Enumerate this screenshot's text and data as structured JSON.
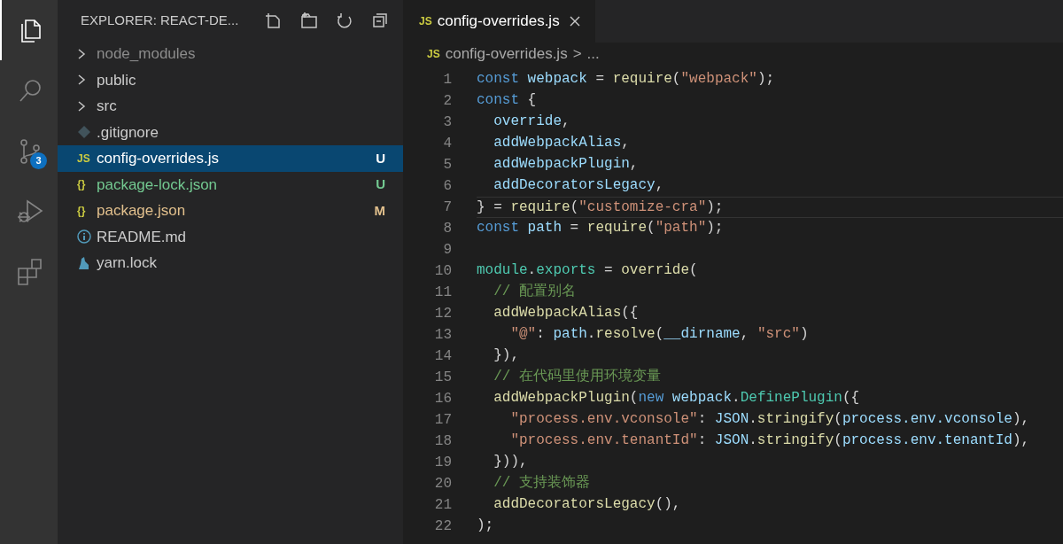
{
  "activity_bar": {
    "items": [
      {
        "kind": "files",
        "selected": true
      },
      {
        "kind": "search",
        "selected": false
      },
      {
        "kind": "source-control",
        "selected": false,
        "badge": "3"
      },
      {
        "kind": "debug",
        "selected": false
      },
      {
        "kind": "extensions",
        "selected": false
      }
    ]
  },
  "sidebar": {
    "title": "EXPLORER: REACT-DE...",
    "tree": [
      {
        "label": "node_modules",
        "kind": "folder",
        "expanded": false,
        "ignored": true
      },
      {
        "label": "public",
        "kind": "folder",
        "expanded": false,
        "ignored": false
      },
      {
        "label": "src",
        "kind": "folder",
        "expanded": false,
        "ignored": false
      },
      {
        "label": ".gitignore",
        "kind": "git-file",
        "selected": false
      },
      {
        "label": "config-overrides.js",
        "kind": "typed-file",
        "icon_text": "JS",
        "status": "U",
        "selected": true
      },
      {
        "label": "package-lock.json",
        "kind": "typed-file",
        "icon_text": "{}",
        "status": "U",
        "selected": false
      },
      {
        "label": "package.json",
        "kind": "typed-file",
        "icon_text": "{}",
        "status": "M",
        "selected": false
      },
      {
        "label": "README.md",
        "kind": "info-file",
        "selected": false
      },
      {
        "label": "yarn.lock",
        "kind": "yarn-file",
        "selected": false
      }
    ]
  },
  "tabs": [
    {
      "label": "config-overrides.js",
      "icon_text": "JS",
      "selected": true
    }
  ],
  "breadcrumb": {
    "icon_text": "JS",
    "file": "config-overrides.js",
    "separator": ">",
    "rest": "..."
  },
  "editor": {
    "lines": [
      {
        "number": "1",
        "current": false,
        "tokens": [
          {
            "text": "const ",
            "kind": "keyword"
          },
          {
            "text": "webpack",
            "kind": "variable"
          },
          {
            "text": " = ",
            "kind": "punct"
          },
          {
            "text": "require",
            "kind": "function"
          },
          {
            "text": "(",
            "kind": "punct"
          },
          {
            "text": "\"webpack\"",
            "kind": "string"
          },
          {
            "text": ");",
            "kind": "punct"
          }
        ]
      },
      {
        "number": "2",
        "current": false,
        "tokens": [
          {
            "text": "const ",
            "kind": "keyword"
          },
          {
            "text": "{",
            "kind": "punct"
          }
        ]
      },
      {
        "number": "3",
        "current": false,
        "tokens": [
          {
            "text": "  override",
            "kind": "variable"
          },
          {
            "text": ",",
            "kind": "punct"
          }
        ]
      },
      {
        "number": "4",
        "current": false,
        "tokens": [
          {
            "text": "  addWebpackAlias",
            "kind": "variable"
          },
          {
            "text": ",",
            "kind": "punct"
          }
        ]
      },
      {
        "number": "5",
        "current": false,
        "tokens": [
          {
            "text": "  addWebpackPlugin",
            "kind": "variable"
          },
          {
            "text": ",",
            "kind": "punct"
          }
        ]
      },
      {
        "number": "6",
        "current": false,
        "tokens": [
          {
            "text": "  addDecoratorsLegacy",
            "kind": "variable"
          },
          {
            "text": ",",
            "kind": "punct"
          }
        ]
      },
      {
        "number": "7",
        "current": true,
        "tokens": [
          {
            "text": "} = ",
            "kind": "punct"
          },
          {
            "text": "require",
            "kind": "function"
          },
          {
            "text": "(",
            "kind": "punct"
          },
          {
            "text": "\"customize-cra\"",
            "kind": "string"
          },
          {
            "text": ");",
            "kind": "punct"
          }
        ]
      },
      {
        "number": "8",
        "current": false,
        "tokens": [
          {
            "text": "const ",
            "kind": "keyword"
          },
          {
            "text": "path",
            "kind": "variable"
          },
          {
            "text": " = ",
            "kind": "punct"
          },
          {
            "text": "require",
            "kind": "function"
          },
          {
            "text": "(",
            "kind": "punct"
          },
          {
            "text": "\"path\"",
            "kind": "string"
          },
          {
            "text": ");",
            "kind": "punct"
          }
        ]
      },
      {
        "number": "9",
        "current": false
      },
      {
        "number": "10",
        "current": false,
        "tokens": [
          {
            "text": "module",
            "kind": "type"
          },
          {
            "text": ".",
            "kind": "punct"
          },
          {
            "text": "exports",
            "kind": "type"
          },
          {
            "text": " = ",
            "kind": "punct"
          },
          {
            "text": "override",
            "kind": "function"
          },
          {
            "text": "(",
            "kind": "punct"
          }
        ]
      },
      {
        "number": "11",
        "current": false,
        "tokens": [
          {
            "text": "  // 配置别名",
            "kind": "comment"
          }
        ]
      },
      {
        "number": "12",
        "current": false,
        "tokens": [
          {
            "text": "  addWebpackAlias",
            "kind": "function"
          },
          {
            "text": "({",
            "kind": "punct"
          }
        ]
      },
      {
        "number": "13",
        "current": false,
        "tokens": [
          {
            "text": "    \"@\"",
            "kind": "string"
          },
          {
            "text": ": ",
            "kind": "punct"
          },
          {
            "text": "path",
            "kind": "variable"
          },
          {
            "text": ".",
            "kind": "punct"
          },
          {
            "text": "resolve",
            "kind": "function"
          },
          {
            "text": "(",
            "kind": "punct"
          },
          {
            "text": "__dirname",
            "kind": "variable"
          },
          {
            "text": ", ",
            "kind": "punct"
          },
          {
            "text": "\"src\"",
            "kind": "string"
          },
          {
            "text": ")",
            "kind": "punct"
          }
        ]
      },
      {
        "number": "14",
        "current": false,
        "tokens": [
          {
            "text": "  }),",
            "kind": "punct"
          }
        ]
      },
      {
        "number": "15",
        "current": false,
        "tokens": [
          {
            "text": "  // 在代码里使用环境变量",
            "kind": "comment"
          }
        ]
      },
      {
        "number": "16",
        "current": false,
        "tokens": [
          {
            "text": "  addWebpackPlugin",
            "kind": "function"
          },
          {
            "text": "(",
            "kind": "punct"
          },
          {
            "text": "new ",
            "kind": "keyword"
          },
          {
            "text": "webpack",
            "kind": "variable"
          },
          {
            "text": ".",
            "kind": "punct"
          },
          {
            "text": "DefinePlugin",
            "kind": "type"
          },
          {
            "text": "({",
            "kind": "punct"
          }
        ]
      },
      {
        "number": "17",
        "current": false,
        "tokens": [
          {
            "text": "    \"process.env.vconsole\"",
            "kind": "string"
          },
          {
            "text": ": ",
            "kind": "punct"
          },
          {
            "text": "JSON",
            "kind": "variable"
          },
          {
            "text": ".",
            "kind": "punct"
          },
          {
            "text": "stringify",
            "kind": "function"
          },
          {
            "text": "(",
            "kind": "punct"
          },
          {
            "text": "process.env.vconsole",
            "kind": "variable"
          },
          {
            "text": "),",
            "kind": "punct"
          }
        ]
      },
      {
        "number": "18",
        "current": false,
        "tokens": [
          {
            "text": "    \"process.env.tenantId\"",
            "kind": "string"
          },
          {
            "text": ": ",
            "kind": "punct"
          },
          {
            "text": "JSON",
            "kind": "variable"
          },
          {
            "text": ".",
            "kind": "punct"
          },
          {
            "text": "stringify",
            "kind": "function"
          },
          {
            "text": "(",
            "kind": "punct"
          },
          {
            "text": "process.env.tenantId",
            "kind": "variable"
          },
          {
            "text": "),",
            "kind": "punct"
          }
        ]
      },
      {
        "number": "19",
        "current": false,
        "tokens": [
          {
            "text": "  })),",
            "kind": "punct"
          }
        ]
      },
      {
        "number": "20",
        "current": false,
        "tokens": [
          {
            "text": "  // 支持装饰器",
            "kind": "comment"
          }
        ]
      },
      {
        "number": "21",
        "current": false,
        "tokens": [
          {
            "text": "  addDecoratorsLegacy",
            "kind": "function"
          },
          {
            "text": "(),",
            "kind": "punct"
          }
        ]
      },
      {
        "number": "22",
        "current": false,
        "tokens": [
          {
            "text": ");",
            "kind": "punct"
          }
        ]
      }
    ]
  }
}
